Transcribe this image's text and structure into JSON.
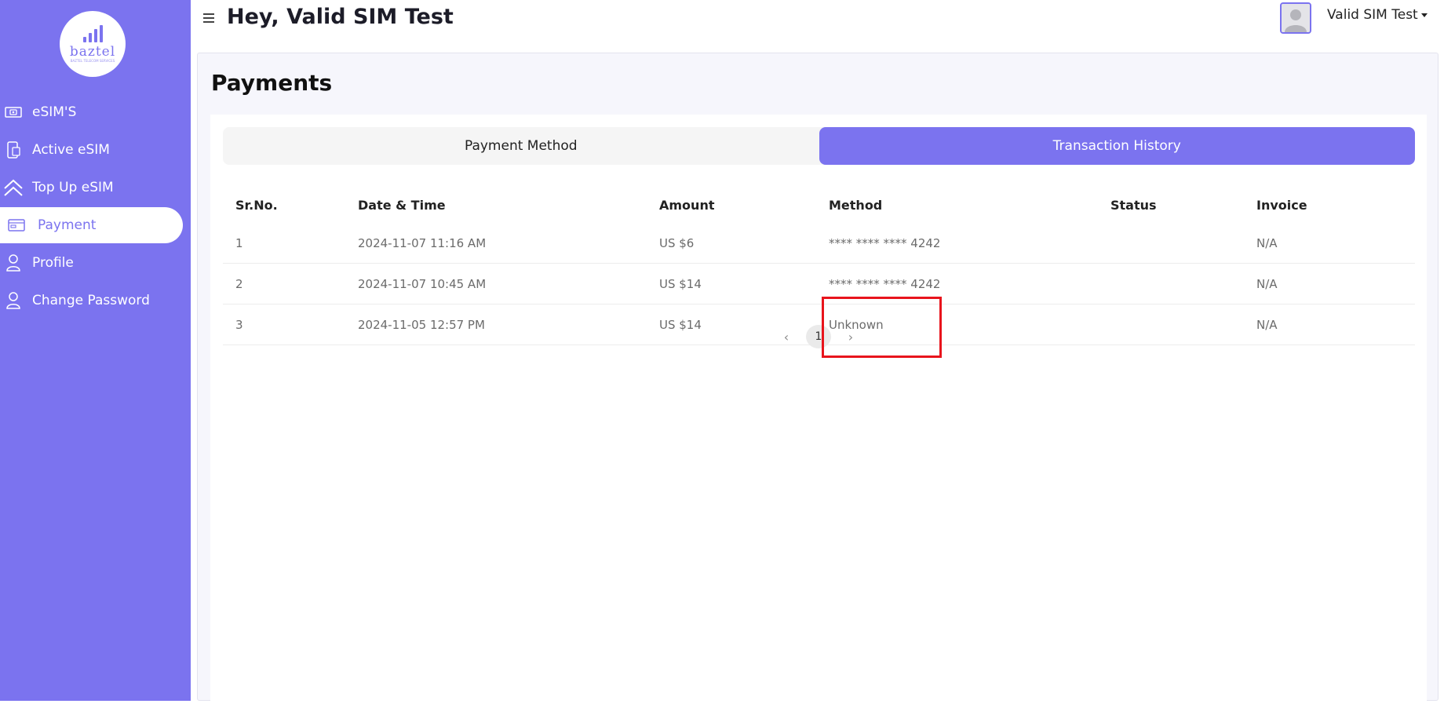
{
  "brand": {
    "logo_text": "baztel",
    "logo_tagline": "BAZTEL TELECOM SERVICES"
  },
  "sidebar": {
    "items": [
      {
        "label": "eSIM'S",
        "icon": "esim-card-icon",
        "active": false
      },
      {
        "label": "Active eSIM",
        "icon": "phone-sim-icon",
        "active": false
      },
      {
        "label": "Top Up eSIM",
        "icon": "double-chevron-up-icon",
        "active": false
      },
      {
        "label": "Payment",
        "icon": "credit-card-icon",
        "active": true
      },
      {
        "label": "Profile",
        "icon": "user-icon",
        "active": false
      },
      {
        "label": "Change Password",
        "icon": "user-icon",
        "active": false
      }
    ]
  },
  "header": {
    "greeting": "Hey, Valid SIM Test",
    "user_name": "Valid SIM Test"
  },
  "page": {
    "title": "Payments"
  },
  "tabs": [
    {
      "label": "Payment Method",
      "active": false
    },
    {
      "label": "Transaction History",
      "active": true
    }
  ],
  "table": {
    "columns": [
      "Sr.No.",
      "Date & Time",
      "Amount",
      "Method",
      "Status",
      "Invoice"
    ],
    "rows": [
      {
        "sr": "1",
        "datetime": "2024-11-07 11:16 AM",
        "amount": "US $6",
        "method": "**** **** **** 4242",
        "status": "",
        "invoice": "N/A"
      },
      {
        "sr": "2",
        "datetime": "2024-11-07 10:45 AM",
        "amount": "US $14",
        "method": "**** **** **** 4242",
        "status": "",
        "invoice": "N/A"
      },
      {
        "sr": "3",
        "datetime": "2024-11-05 12:57 PM",
        "amount": "US $14",
        "method": "Unknown",
        "status": "",
        "invoice": "N/A"
      }
    ]
  },
  "pagination": {
    "prev": "‹",
    "current": "1",
    "next": "›"
  },
  "colors": {
    "accent": "#7b73ef",
    "highlight": "#e8141c"
  }
}
